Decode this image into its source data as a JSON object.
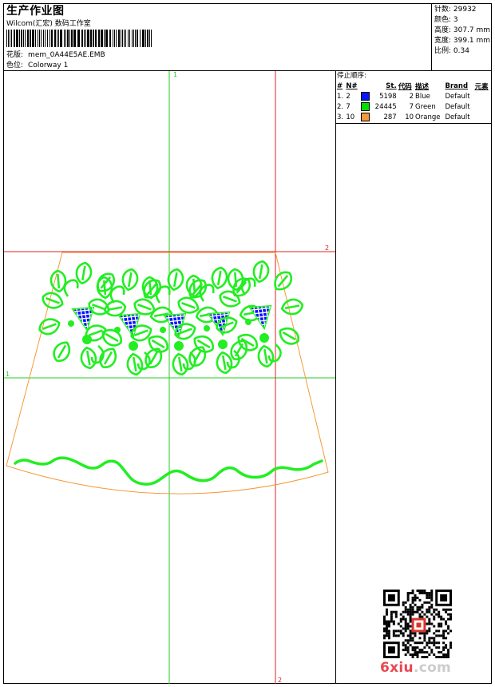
{
  "header": {
    "title": "生产作业图",
    "company": "Wilcom(汇宏) 数码工作室",
    "design_label": "花版:",
    "design_value": "mem_0A44E5AE.EMB",
    "colorway_label": "色位:",
    "colorway_value": "Colorway 1"
  },
  "stats": {
    "stitches": "针数: 29932",
    "colors": "颜色: 3",
    "height": "高度: 307.7 mm",
    "width": "宽度: 399.1 mm",
    "scale": "比例: 0.34"
  },
  "stop_sequence": {
    "title": "停止顺序:",
    "columns": [
      "#",
      "N#",
      "St.",
      "代码",
      "描述",
      "Brand",
      "元素"
    ],
    "rows": [
      {
        "idx": "1.",
        "n": "2",
        "color": "#0a14ff",
        "st": "5198",
        "code": "2",
        "desc": "Blue",
        "brand": "Default"
      },
      {
        "idx": "2.",
        "n": "7",
        "color": "#00e000",
        "st": "24445",
        "code": "7",
        "desc": "Green",
        "brand": "Default"
      },
      {
        "idx": "3.",
        "n": "10",
        "color": "#f59a3a",
        "st": "287",
        "code": "10",
        "desc": "Orange",
        "brand": "Default"
      }
    ]
  },
  "markers": {
    "top_v": "1",
    "right_h": "2",
    "left_h": "1",
    "bottom_v": "2"
  },
  "colors": {
    "green": "#22ee22",
    "blue": "#0a14ff",
    "orange": "#f59a3a",
    "guide_green": "#22cc22",
    "guide_red": "#e02020"
  },
  "watermark": {
    "text_main": "6xiu",
    "text_tld": ".com"
  }
}
